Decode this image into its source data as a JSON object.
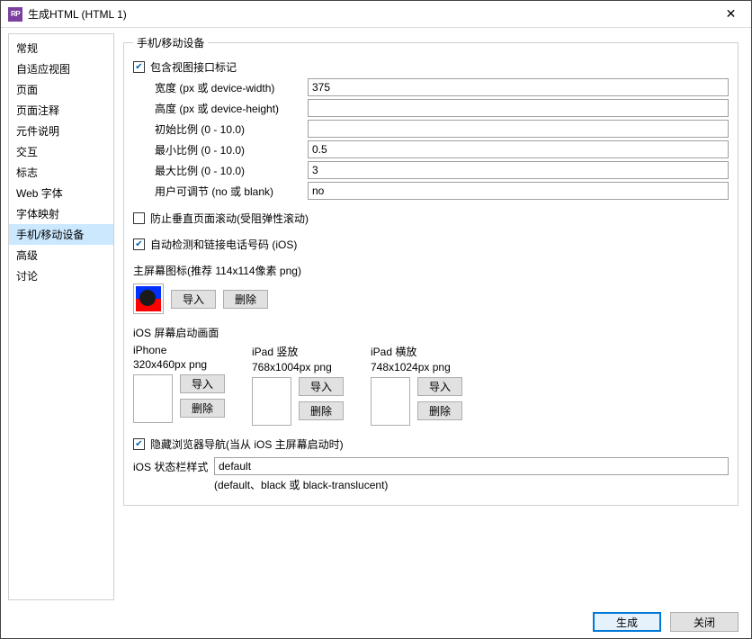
{
  "title": "生成HTML (HTML 1)",
  "close_glyph": "✕",
  "sidebar": {
    "items": [
      {
        "label": "常规"
      },
      {
        "label": "自适应视图"
      },
      {
        "label": "页面"
      },
      {
        "label": "页面注释"
      },
      {
        "label": "元件说明"
      },
      {
        "label": "交互"
      },
      {
        "label": "标志"
      },
      {
        "label": "Web 字体"
      },
      {
        "label": "字体映射"
      },
      {
        "label": "手机/移动设备"
      },
      {
        "label": "高级"
      },
      {
        "label": "讨论"
      }
    ],
    "selected_index": 9
  },
  "group_title": "手机/移动设备",
  "viewport": {
    "include_label": "包含视图接口标记",
    "include_checked": true,
    "width_label": "宽度 (px 或 device-width)",
    "width_value": "375",
    "height_label": "高度 (px 或 device-height)",
    "height_value": "",
    "initial_label": "初始比例 (0 - 10.0)",
    "initial_value": "",
    "min_label": "最小比例 (0 - 10.0)",
    "min_value": "0.5",
    "max_label": "最大比例 (0 - 10.0)",
    "max_value": "3",
    "user_scalable_label": "用户可调节 (no 或 blank)",
    "user_scalable_value": "no"
  },
  "prevent_scroll": {
    "label": "防止垂直页面滚动(受阻弹性滚动)",
    "checked": false
  },
  "auto_tel": {
    "label": "自动检测和链接电话号码 (iOS)",
    "checked": true
  },
  "home_icon": {
    "title": "主屏幕图标(推荐 114x114像素 png)",
    "import_label": "导入",
    "delete_label": "删除"
  },
  "splash": {
    "title": "iOS 屏幕启动画面",
    "iphone": {
      "head": "iPhone",
      "sub": "320x460px png"
    },
    "ipad_p": {
      "head": "iPad 竖放",
      "sub": "768x1004px png"
    },
    "ipad_l": {
      "head": "iPad 横放",
      "sub": "748x1024px png"
    },
    "import_label": "导入",
    "delete_label": "删除"
  },
  "hide_nav": {
    "label": "隐藏浏览器导航(当从 iOS 主屏幕启动时)",
    "checked": true
  },
  "statusbar": {
    "label": "iOS 状态栏样式",
    "value": "default",
    "hint": "(default、black 或 black-translucent)"
  },
  "footer": {
    "generate": "生成",
    "close": "关闭"
  }
}
